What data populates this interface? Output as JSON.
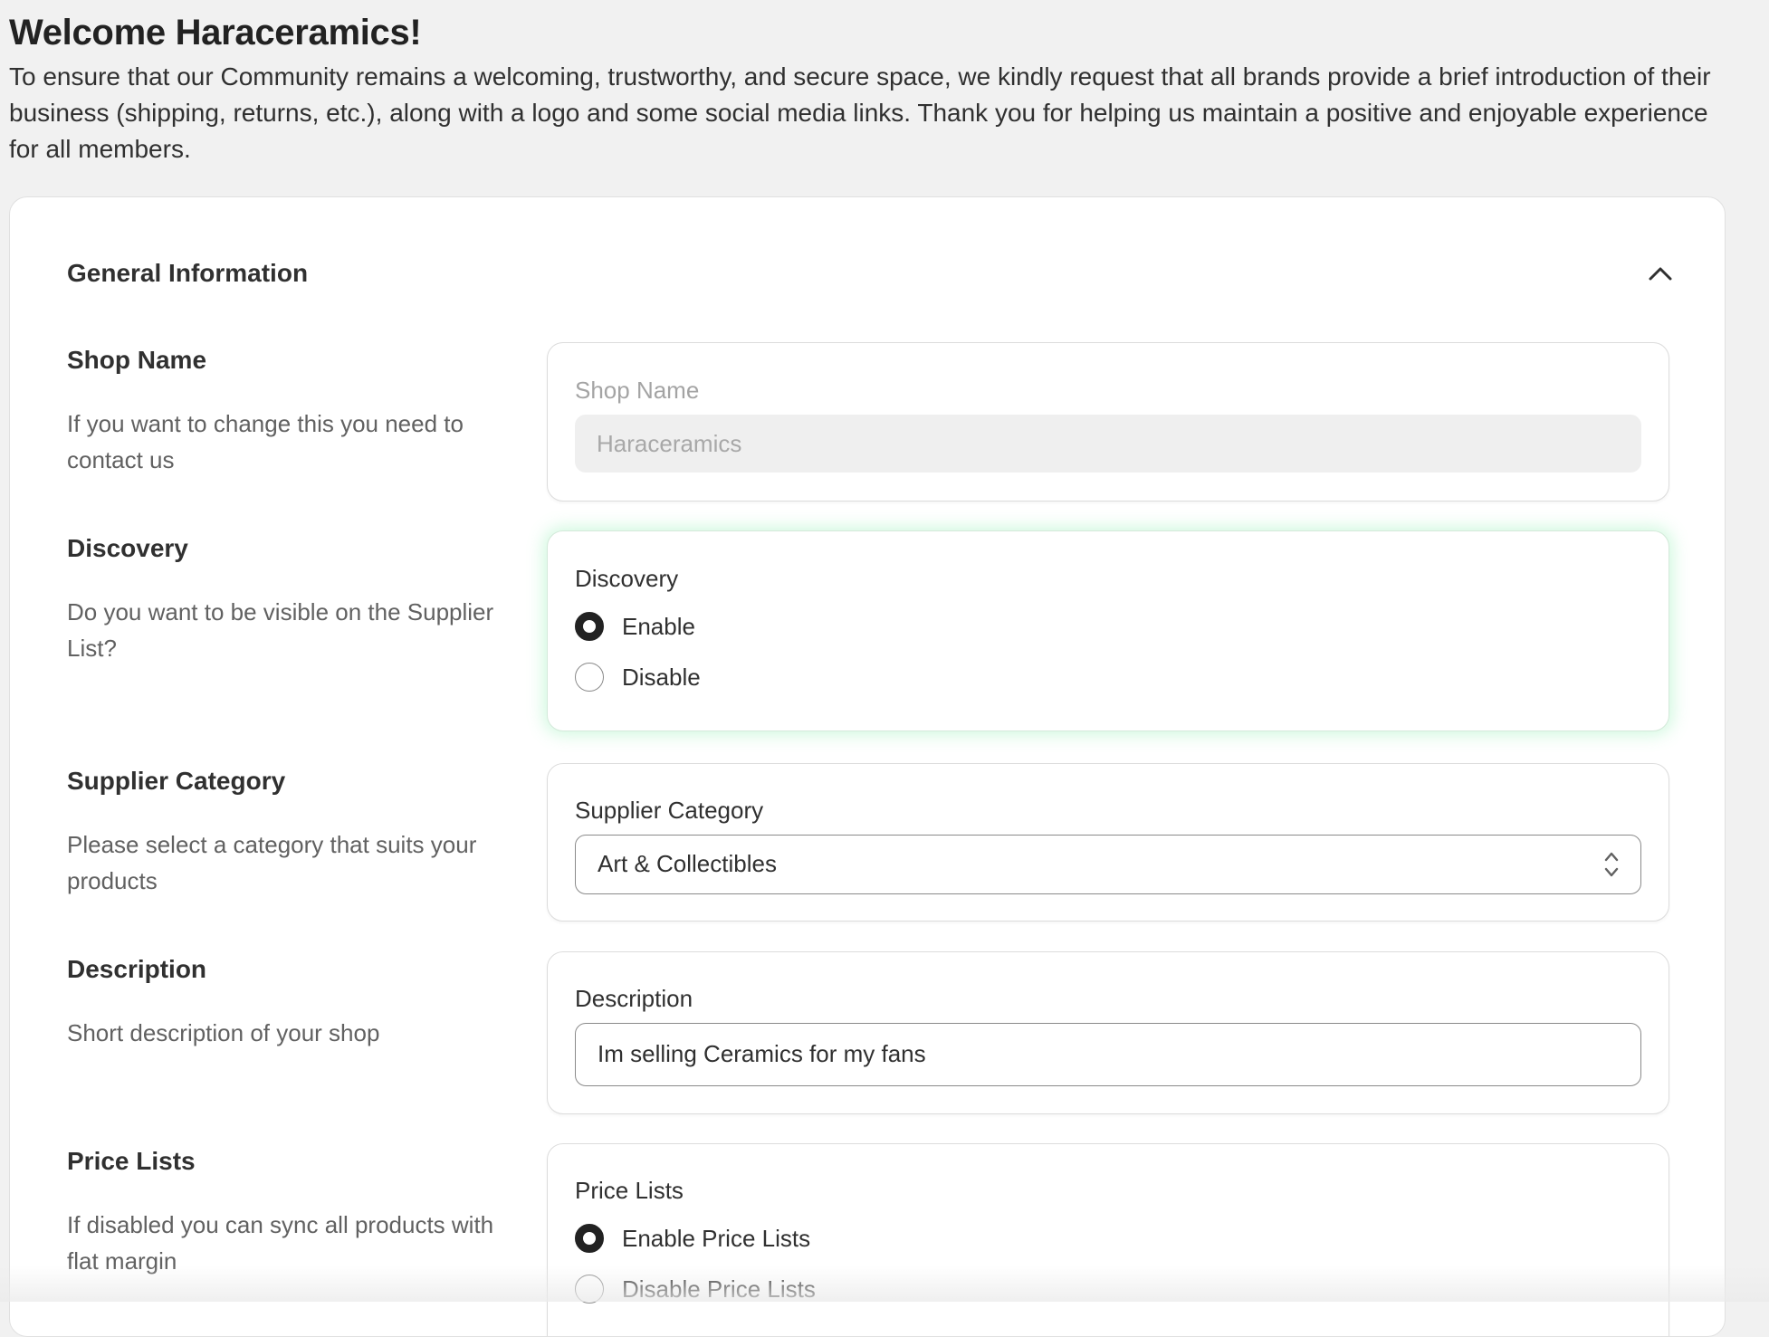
{
  "header": {
    "title": "Welcome Haraceramics!",
    "intro": "To ensure that our Community remains a welcoming, trustworthy, and secure space, we kindly request that all brands provide a brief introduction of their business (shipping, returns, etc.), along with a logo and some social media links. Thank you for helping us maintain a positive and enjoyable experience for all members."
  },
  "section": {
    "title": "General Information",
    "collapse_icon": "chevron-up-icon"
  },
  "shop_name": {
    "title": "Shop Name",
    "description": "If you want to change this you need to contact us",
    "field_label": "Shop Name",
    "value": "Haraceramics"
  },
  "discovery": {
    "title": "Discovery",
    "description": "Do you want to be visible on the Supplier List?",
    "field_label": "Discovery",
    "options": [
      "Enable",
      "Disable"
    ],
    "selected": "Enable"
  },
  "supplier_category": {
    "title": "Supplier Category",
    "description": "Please select a category that suits your products",
    "field_label": "Supplier Category",
    "selected": "Art & Collectibles"
  },
  "description": {
    "title": "Description",
    "description": "Short description of your shop",
    "field_label": "Description",
    "value": "Im selling Ceramics for my fans"
  },
  "price_lists": {
    "title": "Price Lists",
    "description": "If disabled you can sync all products with flat margin",
    "field_label": "Price Lists",
    "options": [
      "Enable Price Lists",
      "Disable Price Lists"
    ],
    "selected": "Enable Price Lists"
  }
}
